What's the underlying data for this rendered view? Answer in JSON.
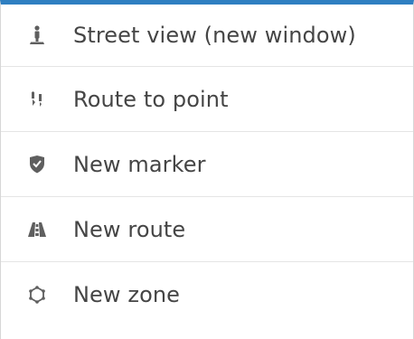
{
  "menu": {
    "accent_color": "#2f7fc1",
    "items": [
      {
        "label": "Street view (new window)",
        "icon": "street-view-icon"
      },
      {
        "label": "Route to point",
        "icon": "route-to-point-icon"
      },
      {
        "label": "New marker",
        "icon": "shield-marker-icon"
      },
      {
        "label": "New route",
        "icon": "road-route-icon"
      },
      {
        "label": "New zone",
        "icon": "zone-polygon-icon"
      }
    ]
  }
}
